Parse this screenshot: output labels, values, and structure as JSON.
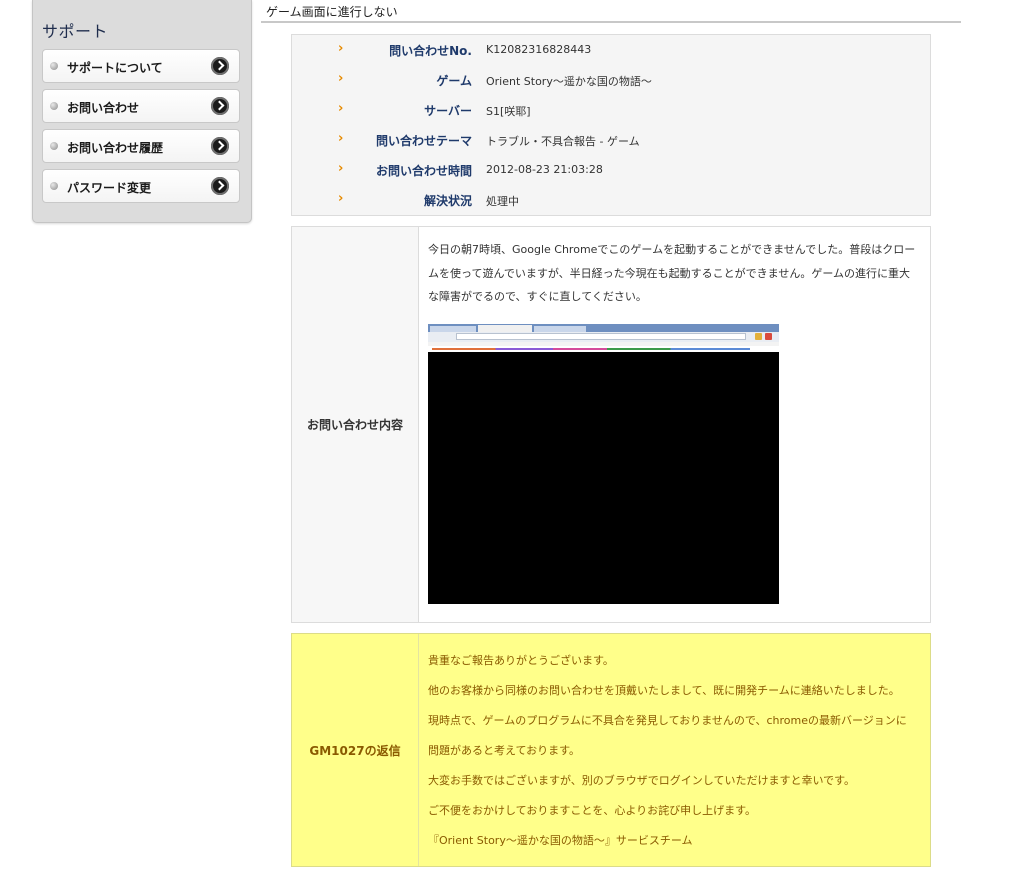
{
  "sidebar": {
    "title": "サポート",
    "items": [
      {
        "label": "サポートについて"
      },
      {
        "label": "お問い合わせ"
      },
      {
        "label": "お問い合わせ履歴"
      },
      {
        "label": "パスワード変更"
      }
    ]
  },
  "header": {
    "title": "ゲーム画面に進行しない"
  },
  "info": {
    "bullet": "›",
    "rows": [
      {
        "label": "問い合わせNo.",
        "value": "K12082316828443"
      },
      {
        "label": "ゲーム",
        "value": "Orient Story〜遥かな国の物語〜"
      },
      {
        "label": "サーバー",
        "value": "S1[咲耶]"
      },
      {
        "label": "問い合わせテーマ",
        "value": "トラブル・不具合報告 - ゲーム"
      },
      {
        "label": "お問い合わせ時間",
        "value": "2012-08-23 21:03:28"
      },
      {
        "label": "解決状況",
        "value": "処理中"
      }
    ]
  },
  "content": {
    "label": "お問い合わせ内容",
    "text": "今日の朝7時頃、Google Chromeでこのゲームを起動することができませんでした。普段はクロームを使って遊んでいますが、半日経った今現在も起動することができません。ゲームの進行に重大な障害がでるので、すぐに直してください。"
  },
  "reply": {
    "label": "GM1027の返信",
    "lines": [
      "貴重なご報告ありがとうございます。",
      "他のお客様から同様のお問い合わせを頂戴いたしまして、既に開発チームに連絡いたしました。",
      "現時点で、ゲームのプログラムに不具合を発見しておりませんので、chromeの最新バージョンに",
      "問題があると考えております。",
      "大変お手数ではございますが、別のブラウザでログインしていただけますと幸いです。",
      "ご不便をおかけしておりますことを、心よりお詫び申し上げます。",
      "『Orient Story〜遥かな国の物語〜』サービスチーム"
    ]
  },
  "colors": {
    "accent_orange": "#e68a00",
    "label_navy": "#1f3a6b",
    "reply_bg": "#ffff8a",
    "reply_text": "#8a5a00"
  }
}
